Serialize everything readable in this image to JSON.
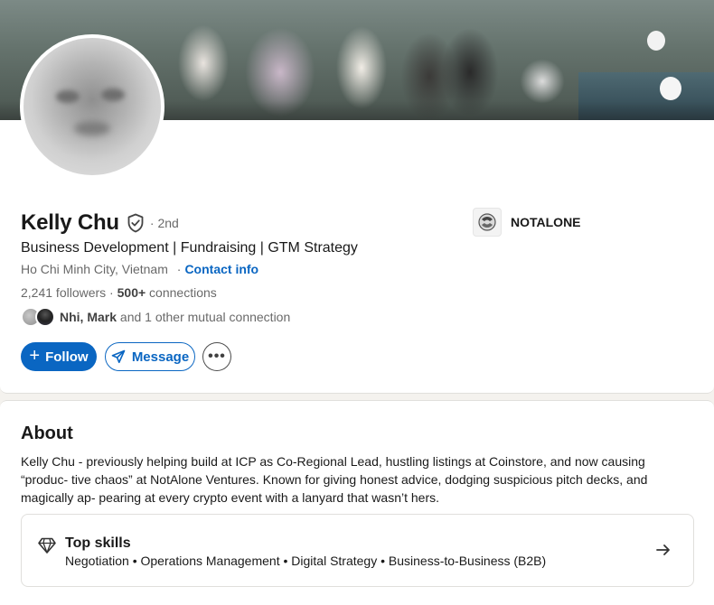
{
  "profile": {
    "name": "Kelly Chu",
    "degree": "· 2nd",
    "headline": "Business Development | Fundraising | GTM Strategy",
    "location": "Ho Chi Minh City, Vietnam",
    "location_sep": "·",
    "contact_info": "Contact info",
    "followers": "2,241 followers",
    "stats_sep": " · ",
    "connections_count": "500+",
    "connections_label": " connections",
    "mutual": {
      "names": "Nhi, Mark",
      "rest": " and 1 other mutual connection"
    },
    "company": {
      "name": "NOTALONE"
    }
  },
  "actions": {
    "follow_plus": "+",
    "follow_label": "Follow",
    "message_label": "Message",
    "more_label": "•••"
  },
  "about": {
    "title": "About",
    "text": "Kelly Chu - previously helping build at ICP as Co-Regional Lead, hustling listings at Coinstore, and now causing “produc- tive chaos” at NotAlone Ventures. Known for giving honest advice, dodging suspicious pitch decks, and magically ap- pearing at every crypto event with a lanyard that wasn’t hers.",
    "top_skills": {
      "title": "Top skills",
      "list": "Negotiation • Operations Management • Digital Strategy • Business-to-Business (B2B)"
    }
  },
  "colors": {
    "accent": "#0a66c2",
    "page_bg": "#f4f2ee",
    "card_bg": "#ffffff"
  },
  "icons": [
    "verified-shield-icon",
    "send-icon",
    "more-icon",
    "company-logo-icon",
    "diamond-icon",
    "arrow-right-icon"
  ]
}
